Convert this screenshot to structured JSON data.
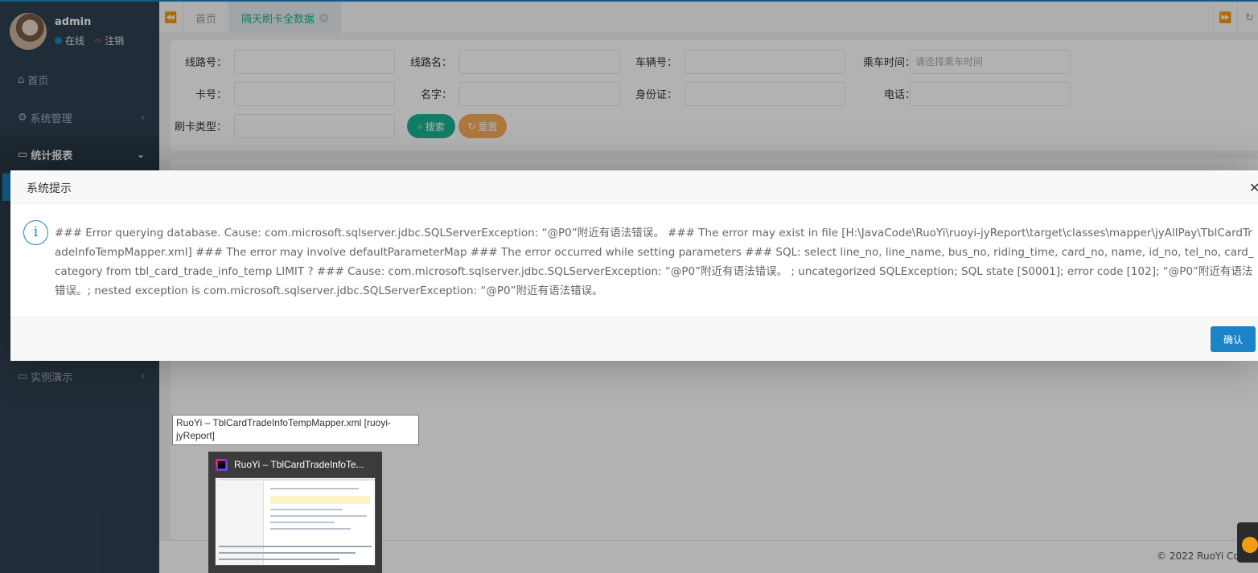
{
  "sidebar": {
    "user": {
      "name": "admin",
      "status": "在线",
      "logout": "注销"
    },
    "menu": [
      {
        "label": "首页",
        "icon": "home-icon"
      },
      {
        "label": "系统管理",
        "icon": "gear-icon"
      },
      {
        "label": "统计报表",
        "icon": "monitor-icon"
      },
      {
        "label": "实例演示",
        "icon": "desktop-icon"
      }
    ]
  },
  "tabs": {
    "home": "首页",
    "current": "隔天刷卡全数据"
  },
  "search": {
    "fields": [
      {
        "label": "线路号：",
        "value": ""
      },
      {
        "label": "线路名：",
        "value": ""
      },
      {
        "label": "车辆号：",
        "value": ""
      },
      {
        "label": "乘车时间：",
        "placeholder": "请选择乘车时间"
      },
      {
        "label": "卡号：",
        "value": ""
      },
      {
        "label": "名字：",
        "value": ""
      },
      {
        "label": "身份证：",
        "value": ""
      },
      {
        "label": "电话：",
        "value": ""
      },
      {
        "label": "刷卡类型：",
        "value": ""
      }
    ],
    "search_button": "搜索",
    "reset_button": "重置"
  },
  "footer": {
    "text": "© 2022 RuoYi Co"
  },
  "dialog": {
    "title": "系统提示",
    "message": "### Error querying database. Cause: com.microsoft.sqlserver.jdbc.SQLServerException: “@P0”附近有语法错误。 ### The error may exist in file [H:\\JavaCode\\RuoYi\\ruoyi-jyReport\\target\\classes\\mapper\\jyAllPay\\TblCardTradeInfoTempMapper.xml] ### The error may involve defaultParameterMap ### The error occurred while setting parameters ### SQL: select line_no, line_name, bus_no, riding_time, card_no, name, id_no, tel_no, card_category from tbl_card_trade_info_temp LIMIT ? ### Cause: com.microsoft.sqlserver.jdbc.SQLServerException: “@P0”附近有语法错误。 ; uncategorized SQLException; SQL state [S0001]; error code [102]; “@P0”附近有语法错误。; nested exception is com.microsoft.sqlserver.jdbc.SQLServerException: “@P0”附近有语法错误。",
    "confirm_button": "确认"
  },
  "taskbar_preview": {
    "tooltip": "RuoYi – TblCardTradeInfoTempMapper.xml [ruoyi-jyReport]",
    "window_title": "RuoYi – TblCardTradeInfoTe..."
  },
  "colors": {
    "sidebar_bg": "#2f4050",
    "primary": "#1c84c6",
    "search_green": "#1ab394",
    "reset_orange": "#f8ac59"
  }
}
